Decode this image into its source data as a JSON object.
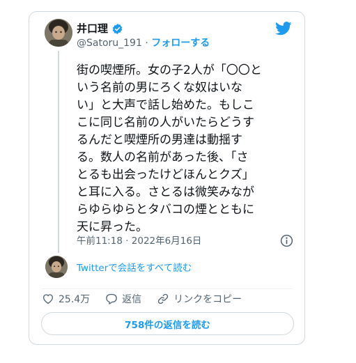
{
  "colors": {
    "accent": "#1d9bf0",
    "text": "#0f1419",
    "muted": "#536471",
    "border": "#cfd9de"
  },
  "author": {
    "name": "井口理",
    "handle": "@Satoru_191",
    "separator": "·",
    "follow_label": "フォローする",
    "verified_icon": "verified-badge-icon"
  },
  "tweet": {
    "text": "街の喫煙所。女の子2人が「〇〇と\nいう名前の男にろくな奴はいな\nい」と大声で話し始めた。もしこ\nこに同じ名前の人がいたらどうす\nるんだと喫煙所の男達は動揺す\nる。数人の名前があった後、「さ\nとるも出会ったけどほんとクズ」\nと耳に入る。さとるは微笑みなが\nらゆらゆらとタバコの煙とともに\n天に昇った。",
    "timestamp": "午前11:18 · 2022年6月16日"
  },
  "conversation_link": "Twitterで会話をすべて読む",
  "actions": {
    "like_count": "25.4万",
    "reply_label": "返信",
    "copy_link_label": "リンクをコピー"
  },
  "replies_button": "758件の返信を読む",
  "icons": [
    "twitter-bird-icon",
    "verified-badge-icon",
    "info-icon",
    "heart-icon",
    "reply-icon",
    "link-icon"
  ]
}
